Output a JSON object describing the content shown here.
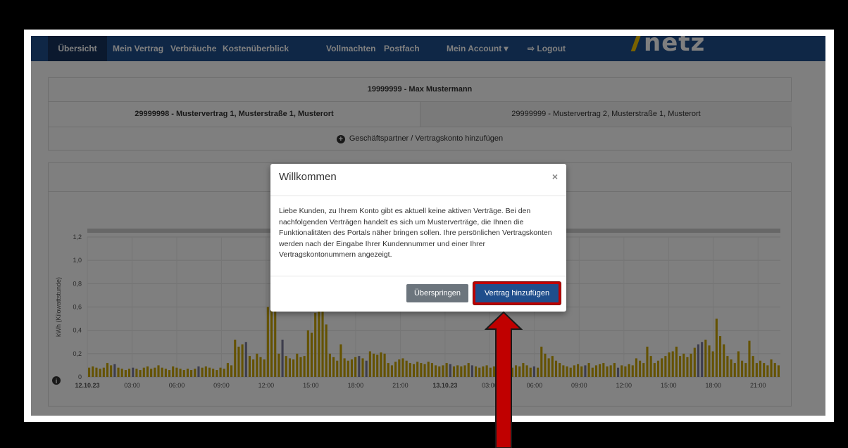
{
  "nav": {
    "items": [
      {
        "label": "Übersicht",
        "active": true
      },
      {
        "label": "Mein Vertrag"
      },
      {
        "label": "Verbräuche"
      },
      {
        "label": "Kostenüberblick"
      },
      {
        "label": "Vollmachten"
      },
      {
        "label": "Postfach"
      },
      {
        "label": "Mein Account ▾"
      },
      {
        "label": "Logout",
        "icon": "logout-icon"
      }
    ],
    "logo": "netz"
  },
  "account": {
    "header": "19999999 - Max Mustermann",
    "contract_active": "29999998 - Mustervertrag 1, Musterstraße 1, Musterort",
    "contract_other": "29999999 - Mustervertrag 2, Musterstraße 1, Musterort",
    "add_link": "Geschäftspartner / Vertragskonto hinzufügen"
  },
  "chart_data": {
    "type": "bar",
    "ylabel": "kWh (Kilowattstunde)",
    "ylim": [
      0,
      1.2
    ],
    "y_ticks": [
      "0",
      "0,2",
      "0,4",
      "0,6",
      "0,8",
      "1,0",
      "1,2"
    ],
    "x_ticks": [
      "12.10.23",
      "03:00",
      "06:00",
      "09:00",
      "12:00",
      "15:00",
      "18:00",
      "21:00",
      "13.10.23",
      "03:00",
      "06:00",
      "09:00",
      "12:00",
      "15:00",
      "18:00",
      "21:00"
    ],
    "bar_color": "#c9a400",
    "values": [
      0.08,
      0.09,
      0.08,
      0.07,
      0.08,
      0.12,
      0.1,
      0.11,
      0.08,
      0.07,
      0.06,
      0.07,
      0.08,
      0.07,
      0.06,
      0.08,
      0.09,
      0.07,
      0.08,
      0.1,
      0.08,
      0.07,
      0.06,
      0.09,
      0.08,
      0.07,
      0.06,
      0.07,
      0.06,
      0.07,
      0.09,
      0.08,
      0.09,
      0.08,
      0.07,
      0.06,
      0.08,
      0.07,
      0.12,
      0.1,
      0.32,
      0.26,
      0.28,
      0.3,
      0.18,
      0.15,
      0.2,
      0.17,
      0.15,
      0.6,
      0.62,
      0.65,
      0.2,
      0.32,
      0.18,
      0.16,
      0.15,
      0.2,
      0.17,
      0.18,
      0.4,
      0.38,
      0.55,
      0.6,
      0.56,
      0.45,
      0.2,
      0.17,
      0.14,
      0.28,
      0.16,
      0.14,
      0.15,
      0.17,
      0.18,
      0.16,
      0.14,
      0.22,
      0.2,
      0.19,
      0.21,
      0.2,
      0.12,
      0.1,
      0.13,
      0.15,
      0.16,
      0.14,
      0.12,
      0.11,
      0.13,
      0.12,
      0.11,
      0.13,
      0.12,
      0.1,
      0.09,
      0.1,
      0.12,
      0.11,
      0.09,
      0.1,
      0.09,
      0.1,
      0.12,
      0.1,
      0.09,
      0.08,
      0.09,
      0.1,
      0.08,
      0.09,
      0.1,
      0.09,
      0.08,
      0.1,
      0.08,
      0.1,
      0.09,
      0.12,
      0.1,
      0.08,
      0.09,
      0.08,
      0.26,
      0.2,
      0.16,
      0.18,
      0.14,
      0.12,
      0.1,
      0.09,
      0.08,
      0.1,
      0.11,
      0.09,
      0.1,
      0.12,
      0.08,
      0.1,
      0.11,
      0.12,
      0.09,
      0.1,
      0.12,
      0.08,
      0.1,
      0.09,
      0.11,
      0.1,
      0.16,
      0.14,
      0.12,
      0.26,
      0.18,
      0.12,
      0.14,
      0.16,
      0.18,
      0.21,
      0.22,
      0.26,
      0.18,
      0.2,
      0.17,
      0.2,
      0.25,
      0.28,
      0.3,
      0.32,
      0.27,
      0.22,
      0.5,
      0.35,
      0.28,
      0.18,
      0.15,
      0.12,
      0.22,
      0.14,
      0.12,
      0.31,
      0.18,
      0.12,
      0.14,
      0.12,
      0.1,
      0.15,
      0.12,
      0.1
    ]
  },
  "modal": {
    "title": "Willkommen",
    "close": "×",
    "body": "Liebe Kunden, zu Ihrem Konto gibt es aktuell keine aktiven Verträge. Bei den nachfolgenden Verträgen handelt es sich um Musterverträge, die Ihnen die Funktionalitäten des Portals näher bringen sollen. Ihre persönlichen Vertragskonten werden nach der Eingabe Ihrer Kundennummer und einer Ihrer Vertragskontonummern angezeigt.",
    "skip_label": "Überspringen",
    "add_label": "Vertrag hinzufügen"
  },
  "colors": {
    "nav": "#1f4e8c",
    "highlight": "#c00000",
    "arrow": "#c00000"
  }
}
